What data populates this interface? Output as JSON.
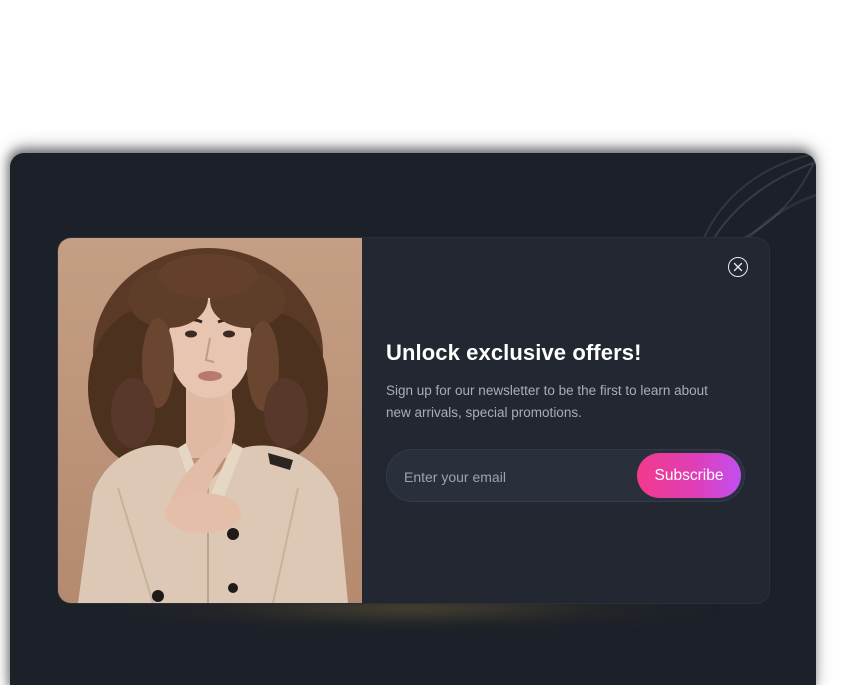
{
  "popup": {
    "title": "Unlock exclusive offers!",
    "subtitle": "Sign up for our newsletter to be the first to learn about new arrivals, special promotions.",
    "email_placeholder": "Enter your email",
    "email_value": "",
    "subscribe_label": "Subscribe",
    "close_icon": "close-circle-icon",
    "image_subject": "woman-in-beige-trench-coat"
  },
  "colors": {
    "page_background": "#ffffff",
    "backdrop": "#1c2029",
    "card": "#232732",
    "input_background": "#2a2f3c",
    "title_text": "#ffffff",
    "body_text": "#a9adb8",
    "button_gradient_start": "#f23a8c",
    "button_gradient_end": "#c14ff0"
  }
}
